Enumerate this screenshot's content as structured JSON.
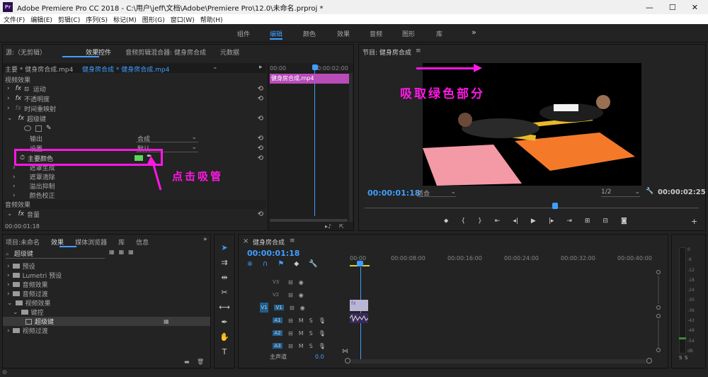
{
  "app": {
    "title": "Adobe Premiere Pro CC 2018 - C:\\用户\\jeff\\文档\\Adobe\\Premiere Pro\\12.0\\未命名.prproj *",
    "icon": "Pr"
  },
  "menu": [
    "文件(F)",
    "编辑(E)",
    "剪辑(C)",
    "序列(S)",
    "标记(M)",
    "图形(G)",
    "窗口(W)",
    "帮助(H)"
  ],
  "workspaces": {
    "items": [
      "组件",
      "编辑",
      "颜色",
      "效果",
      "音频",
      "图形",
      "库"
    ],
    "active": "编辑",
    "more": "»"
  },
  "source_panel": {
    "tabs": [
      "源:（无剪辑）",
      "效果控件",
      "音频剪辑混合器: 健身房合成",
      "元数据"
    ],
    "menu_icon": "≡",
    "clip_path": "主要 * 健身房合成.mp4",
    "clip_link": "健身房合成 * 健身房合成.mp4",
    "ruler": [
      "00:00",
      "00:00:02:00"
    ],
    "clip_bar_label": "健身房合成.mp4",
    "video_section": "视频效果",
    "rows": [
      {
        "fx": "fx",
        "label": "运动",
        "icon": "transform-icon"
      },
      {
        "fx": "fx",
        "label": "不透明度"
      },
      {
        "fx": "fx",
        "label": "时间重映射"
      },
      {
        "fx": "fx",
        "label": "超级键"
      }
    ],
    "output_label": "输出",
    "output_value": "合成",
    "settings_label": "设置",
    "settings_value": "默认",
    "key_color_label": "主要颜色",
    "sub_rows": [
      "遮罩生成",
      "遮罩清除",
      "溢出抑制",
      "颜色校正"
    ],
    "audio_section": "音频效果",
    "volume_label": "音量",
    "timecode": "00:00:01:18"
  },
  "program_panel": {
    "title": "节目: 健身房合成",
    "menu_icon": "≡",
    "timecode_left": "00:00:01:18",
    "fit": "适合",
    "resolution": "1/2",
    "timecode_right": "00:00:02:25"
  },
  "annotations": {
    "pick_green": "吸取绿色部分",
    "click_eyedropper": "点击吸管",
    "color": "#ff17e4"
  },
  "project_panel": {
    "tabs": [
      "项目:未命名",
      "效果",
      "媒体浏览器",
      "库",
      "信息"
    ],
    "search_value": "超级键",
    "tree": [
      {
        "label": "预设",
        "level": 0
      },
      {
        "label": "Lumetri 预设",
        "level": 0
      },
      {
        "label": "音频效果",
        "level": 0
      },
      {
        "label": "音频过渡",
        "level": 0
      },
      {
        "label": "视频效果",
        "level": 0,
        "open": true
      },
      {
        "label": "键控",
        "level": 1,
        "open": true
      },
      {
        "label": "超级键",
        "level": 2,
        "selected": true
      },
      {
        "label": "视频过渡",
        "level": 0
      }
    ]
  },
  "timeline": {
    "title": "健身房合成",
    "menu_icon": "≡",
    "timecode": "00:00:01:18",
    "ruler": [
      "00:00",
      "00:00:08:00",
      "00:00:16:00",
      "00:00:24:00",
      "00:00:32:00",
      "00:00:40:00"
    ],
    "video_tracks": [
      "V3",
      "V2",
      "V1"
    ],
    "audio_tracks": [
      "A1",
      "A2",
      "A3"
    ],
    "master_label": "主声道",
    "master_value": "0.0",
    "track_letters": {
      "m": "M",
      "s": "S"
    }
  },
  "meter": {
    "scale": [
      "0",
      "-6",
      "-12",
      "-18",
      "-24",
      "-30",
      "-36",
      "-42",
      "-48",
      "-54",
      "dB"
    ],
    "labels": [
      "S",
      "S"
    ]
  },
  "colors": {
    "accent": "#3f9eff",
    "key_green": "#5bd55b",
    "clip_purple": "#a04fa0",
    "playhead": "#3f9eff",
    "annotation": "#ff17e4"
  }
}
